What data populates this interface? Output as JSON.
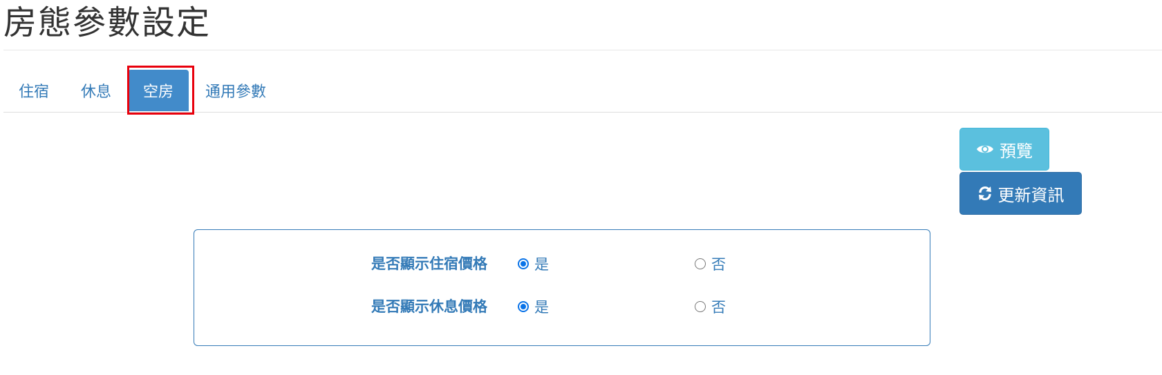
{
  "page": {
    "title": "房態參數設定"
  },
  "tabs": [
    {
      "label": "住宿",
      "active": false
    },
    {
      "label": "休息",
      "active": false
    },
    {
      "label": "空房",
      "active": true
    },
    {
      "label": "通用參數",
      "active": false
    }
  ],
  "actions": {
    "preview_label": "預覽",
    "preview_icon": "eye-icon",
    "refresh_label": "更新資訊",
    "refresh_icon": "refresh-icon"
  },
  "settings": [
    {
      "label": "是否顯示住宿價格",
      "yes": "是",
      "no": "否",
      "selected": "yes"
    },
    {
      "label": "是否顯示休息價格",
      "yes": "是",
      "no": "否",
      "selected": "yes"
    }
  ],
  "colors": {
    "link": "#337ab7",
    "active_tab": "#428bca",
    "preview_button": "#5bc0de",
    "refresh_button": "#337ab7",
    "highlight_box": "#e8000c"
  }
}
